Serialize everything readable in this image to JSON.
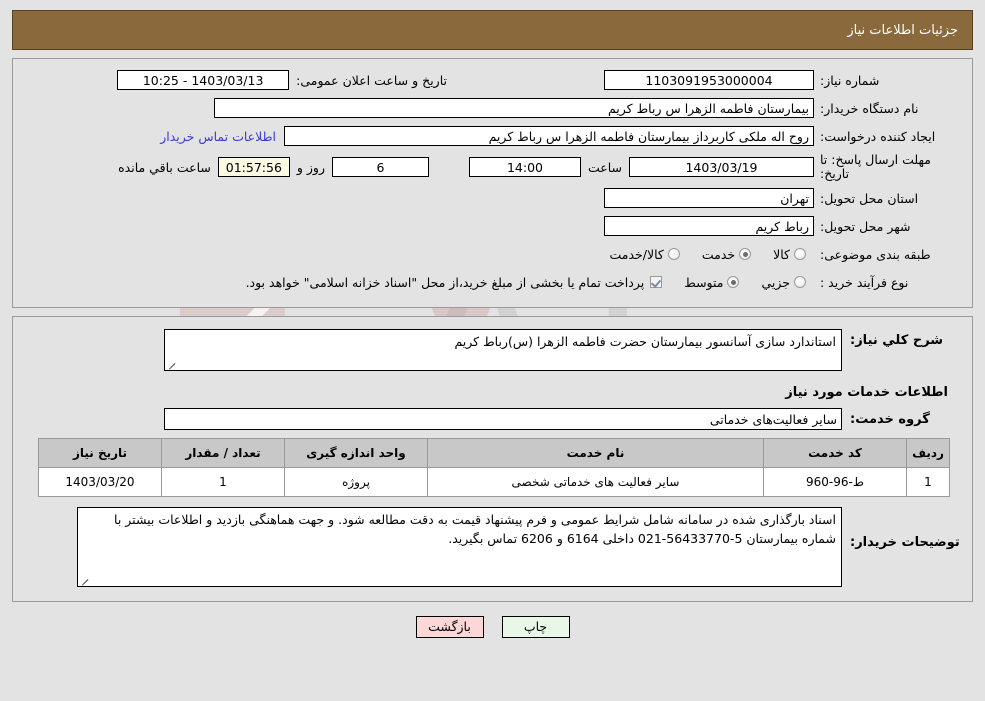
{
  "header": {
    "title": "جزئیات اطلاعات نیاز"
  },
  "top": {
    "need_number_label": "شماره نیاز:",
    "need_number_value": "1103091953000004",
    "announce_datetime_label": "تاریخ و ساعت اعلان عمومی:",
    "announce_datetime_value": "1403/03/13 - 10:25",
    "buyer_org_label": "نام دستگاه خریدار:",
    "buyer_org_value": "بیمارستان فاطمه الزهرا س  رباط کریم",
    "requester_label": "ایجاد کننده درخواست:",
    "requester_value": "روح اله ملکی کاربرداز  بیمارستان فاطمه الزهرا س  رباط کریم",
    "contact_link": "اطلاعات تماس خریدار",
    "deadline_label": "مهلت ارسال پاسخ: تا تاریخ:",
    "deadline_date": "1403/03/19",
    "hour_label": "ساعت",
    "hour_value": "14:00",
    "days_value": "6",
    "days_label": "روز و",
    "remaining_value": "01:57:56",
    "remaining_label": "ساعت باقي مانده",
    "province_label": "استان محل تحویل:",
    "province_value": "تهران",
    "city_label": "شهر محل تحویل:",
    "city_value": "رباط کریم",
    "category_label": "طبقه بندی موضوعی:",
    "category_options": [
      {
        "label": "کالا",
        "selected": false
      },
      {
        "label": "خدمت",
        "selected": true
      },
      {
        "label": "کالا/خدمت",
        "selected": false
      }
    ],
    "process_label": "نوع فرآیند خرید :",
    "process_options": [
      {
        "label": "جزیي",
        "selected": false
      },
      {
        "label": "متوسط",
        "selected": true
      }
    ],
    "treasury_checkbox_checked": true,
    "treasury_text": "پرداخت تمام یا بخشی از مبلغ خرید،از محل \"اسناد خزانه اسلامی\" خواهد بود."
  },
  "middle": {
    "need_desc_label": "شرح کلي نیاز:",
    "need_desc_value": "استاندارد سازی آسانسور بیمارستان حضرت فاطمه الزهرا (س)رباط کریم",
    "services_section_title": "اطلاعات خدمات مورد نیاز",
    "service_group_label": "گروه خدمت:",
    "service_group_value": "سایر فعالیت‌های خدماتی"
  },
  "table": {
    "columns": [
      "ردیف",
      "کد خدمت",
      "نام خدمت",
      "واحد اندازه گیری",
      "تعداد / مقدار",
      "تاریخ نیاز"
    ],
    "rows": [
      {
        "row_no": "1",
        "service_code": "ط-96-960",
        "service_name": "سایر فعالیت های خدماتی شخصی",
        "unit": "پروژه",
        "quantity": "1",
        "need_date": "1403/03/20"
      }
    ]
  },
  "buyer_notes": {
    "label": "توضیحات خریدار:",
    "value": "اسناد بارگذاری شده در سامانه شامل شرایط عمومی و فرم پیشنهاد قیمت به دقت مطالعه شود. و جهت هماهنگی بازدید و اطلاعات بیشتر با شماره بیمارستان 5-56433770-021 داخلی 6164 و 6206 تماس بگیرید."
  },
  "footer": {
    "print_label": "چاپ",
    "back_label": "بازگشت"
  },
  "colors": {
    "header_bg": "#8a6a3c",
    "link": "#3b3bd0",
    "print_btn": "#e9f7e9",
    "back_btn": "#fbd7d7",
    "timer_bg": "#fbfbe4"
  },
  "watermark": {
    "text": "AriaTender.net"
  }
}
